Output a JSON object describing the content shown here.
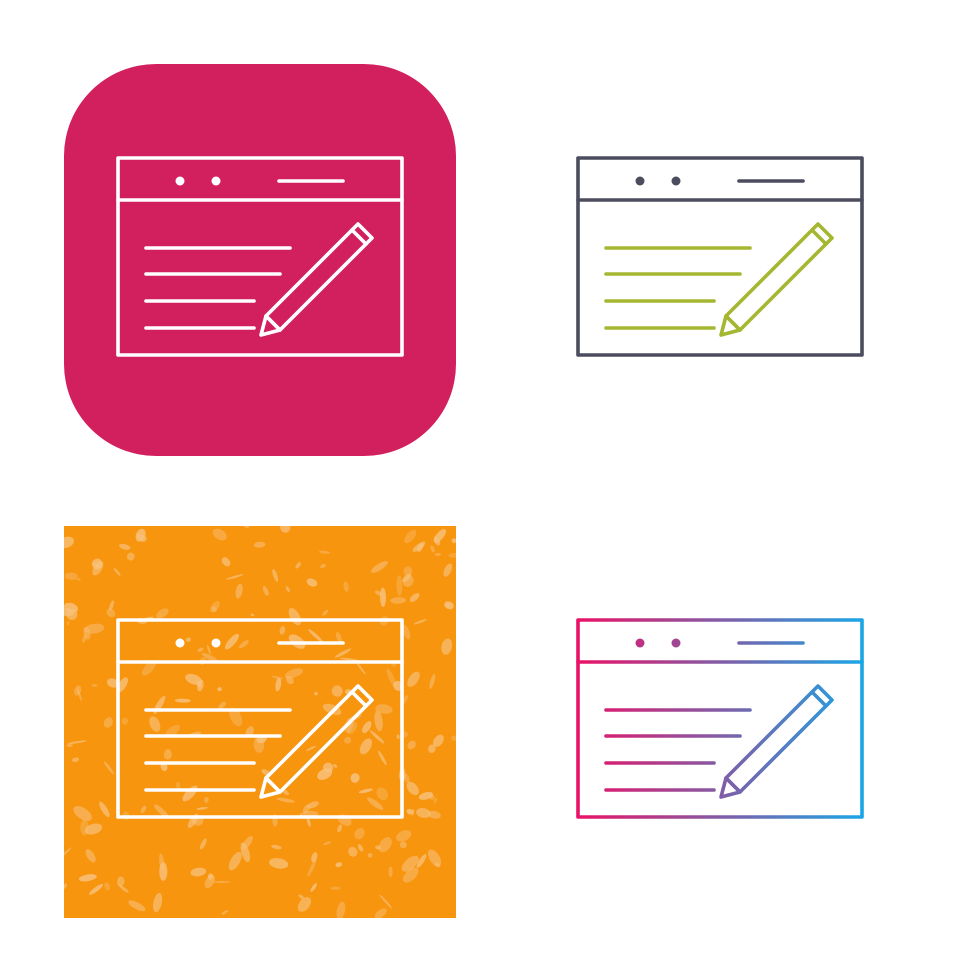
{
  "icon_set": {
    "icon_name": "web-page-edit-icon",
    "variants": [
      {
        "name": "glyph-on-rounded-square",
        "background": "rounded-square",
        "background_color": "#d21f5e",
        "frame_color": "#ffffff",
        "text_lines_color": "#ffffff",
        "pencil_color": "#ffffff"
      },
      {
        "name": "two-tone-line",
        "background": "none",
        "frame_color": "#4b4c5e",
        "text_lines_color": "#a5b731",
        "pencil_color": "#a5b731"
      },
      {
        "name": "glyph-on-grunge-square",
        "background": "square-textured",
        "background_color": "#f7950e",
        "texture_color": "#f8c27e",
        "frame_color": "#ffffff",
        "text_lines_color": "#ffffff",
        "pencil_color": "#ffffff"
      },
      {
        "name": "gradient-line",
        "background": "none",
        "gradient_start": "#ea1266",
        "gradient_end": "#1aa6e6"
      }
    ]
  }
}
